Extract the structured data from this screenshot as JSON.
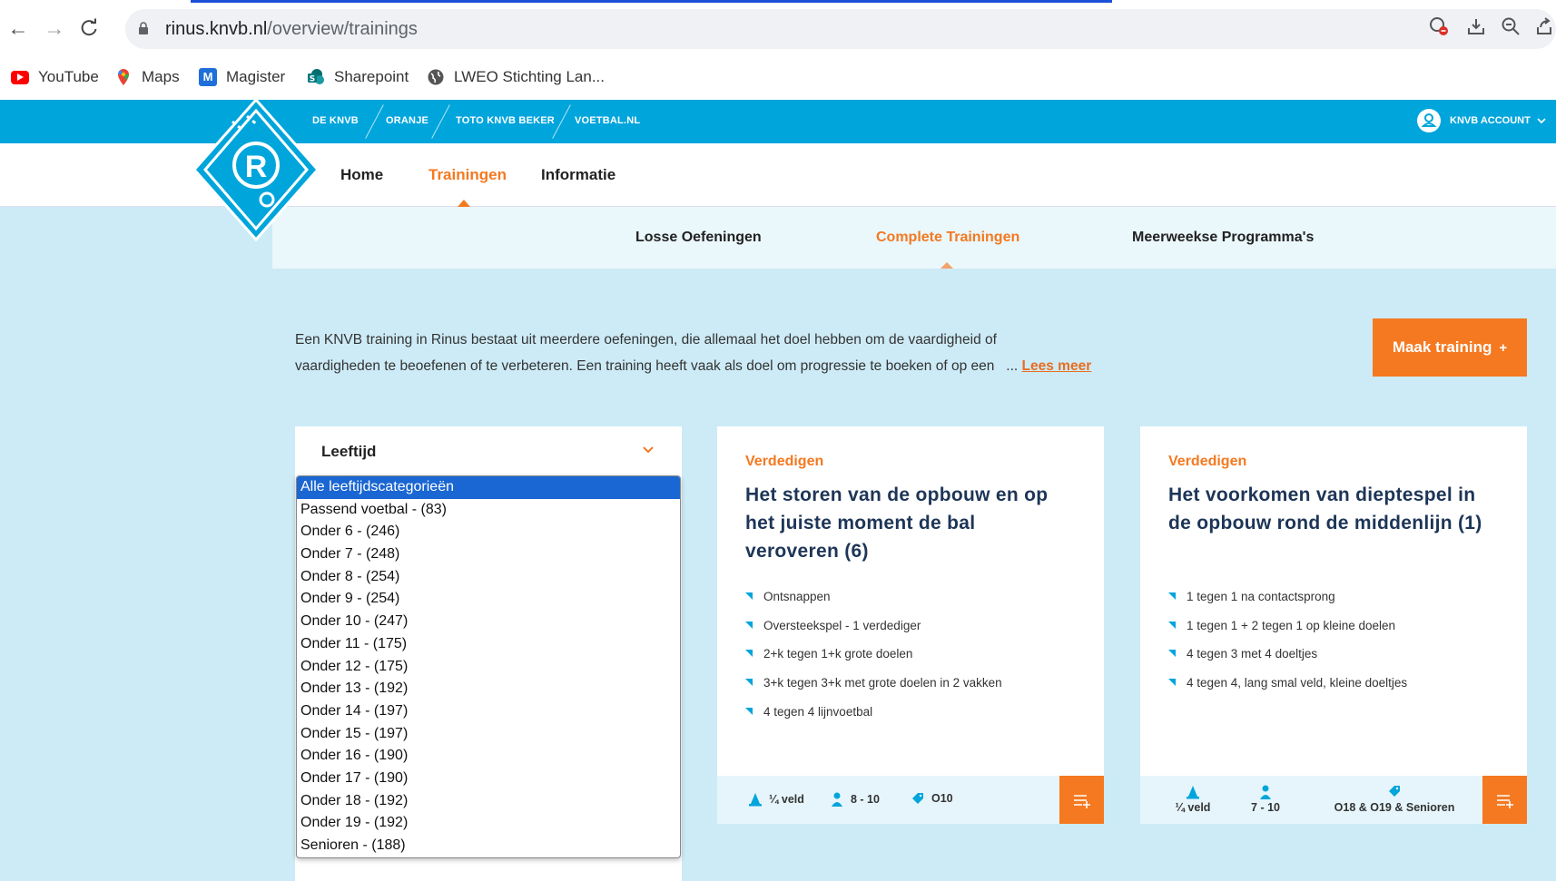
{
  "browser": {
    "url_domain": "rinus.knvb.nl",
    "url_path": "/overview/trainings",
    "nav": {
      "back": "←",
      "forward": "→",
      "reload": "C"
    },
    "bookmarks": [
      {
        "label": "YouTube",
        "icon": "youtube-icon",
        "color": "#ff0000"
      },
      {
        "label": "Maps",
        "icon": "maps-icon",
        "color": "#34a853"
      },
      {
        "label": "Magister",
        "icon": "magister-icon",
        "color": "#1e6fd9"
      },
      {
        "label": "Sharepoint",
        "icon": "sharepoint-icon",
        "color": "#038387"
      },
      {
        "label": "LWEO Stichting Lan...",
        "icon": "globe-icon",
        "color": "#555555"
      }
    ]
  },
  "topnav": {
    "items": [
      "DE KNVB",
      "ORANJE",
      "TOTO KNVB BEKER",
      "VOETBAL.NL"
    ],
    "account": "KNVB ACCOUNT"
  },
  "mainnav": {
    "items": [
      "Home",
      "Trainingen",
      "Informatie"
    ],
    "active": "Trainingen"
  },
  "subnav": {
    "items": [
      "Losse Oefeningen",
      "Complete Trainingen",
      "Meerweekse Programma's"
    ],
    "active": "Complete Trainingen"
  },
  "intro": {
    "line1": "Een KNVB training in Rinus bestaat uit meerdere oefeningen, die allemaal het doel hebben om de vaardigheid of",
    "line2": "vaardigheden te beoefenen of te verbeteren. Een training heeft vaak als doel om progressie te boeken of op een",
    "ellipsis": "...",
    "read_more": "Lees meer"
  },
  "make_training": {
    "label": "Maak training",
    "icon": "+"
  },
  "filter": {
    "label": "Leeftijd",
    "options": [
      "Alle leeftijdscategorieën",
      "Passend voetbal - (83)",
      "Onder 6 - (246)",
      "Onder 7 - (248)",
      "Onder 8 - (254)",
      "Onder 9 - (254)",
      "Onder 10 - (247)",
      "Onder 11 - (175)",
      "Onder 12 - (175)",
      "Onder 13 - (192)",
      "Onder 14 - (197)",
      "Onder 15 - (197)",
      "Onder 16 - (190)",
      "Onder 17 - (190)",
      "Onder 18 - (192)",
      "Onder 19 - (192)",
      "Senioren - (188)"
    ],
    "selected": "Alle leeftijdscategorieën"
  },
  "cards": [
    {
      "category": "Verdedigen",
      "title": "Het storen van de opbouw en op het juiste moment de bal veroveren (6)",
      "exercises": [
        "Ontsnappen",
        "Oversteekspel - 1 verdediger",
        "2+k tegen 1+k grote doelen",
        "3+k tegen 3+k met grote doelen in 2 vakken",
        "4 tegen 4 lijnvoetbal"
      ],
      "field": "¼ veld",
      "players": "8 - 10",
      "age": "O10"
    },
    {
      "category": "Verdedigen",
      "title": "Het voorkomen van dieptespel in de opbouw rond de middenlijn (1)",
      "exercises": [
        "1 tegen 1 na contactsprong",
        "1 tegen 1 + 2 tegen 1 op kleine doelen",
        "4 tegen 3 met 4 doeltjes",
        "4 tegen 4, lang smal veld, kleine doeltjes"
      ],
      "field": "¼ veld",
      "players": "7 - 10",
      "age": "O18 & O19 & Senioren"
    }
  ],
  "colors": {
    "accent": "#f47920",
    "brand_blue": "#00a5dc",
    "title_navy": "#1d3557",
    "page_bg": "#cdebf6"
  }
}
